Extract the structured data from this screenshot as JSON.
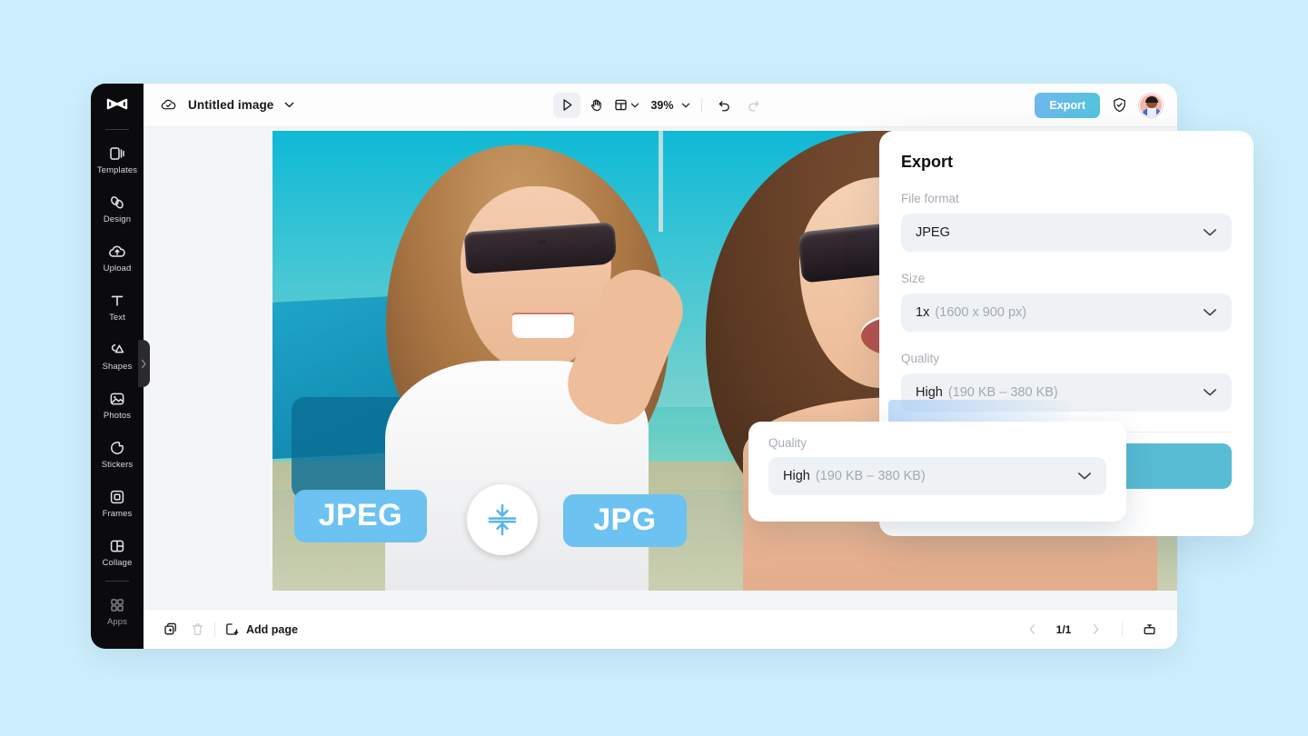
{
  "theme": {
    "page_bg": "#cdeefc",
    "rail_bg": "#0b0b0d",
    "canvas_bg": "#f4f5f7",
    "accent_blue": "#57bcd4",
    "badge_blue": "#6cc2f0",
    "export_gradient_from": "#6fb7ef",
    "export_gradient_to": "#54c3dd"
  },
  "sidebar": {
    "logo": "capcut-logo-icon",
    "items": [
      {
        "label": "Templates",
        "icon": "templates-icon"
      },
      {
        "label": "Design",
        "icon": "design-icon"
      },
      {
        "label": "Upload",
        "icon": "upload-cloud-icon"
      },
      {
        "label": "Text",
        "icon": "text-t-icon"
      },
      {
        "label": "Shapes",
        "icon": "shapes-icon"
      },
      {
        "label": "Photos",
        "icon": "photo-icon"
      },
      {
        "label": "Stickers",
        "icon": "sticker-icon"
      },
      {
        "label": "Frames",
        "icon": "frame-icon"
      },
      {
        "label": "Collage",
        "icon": "collage-icon"
      },
      {
        "label": "Apps",
        "icon": "apps-grid-icon"
      }
    ],
    "collapse_handle_icon": "chevron-right-icon"
  },
  "header": {
    "cloud_status_icon": "cloud-check-icon",
    "doc_title": "Untitled image",
    "doc_title_chevron_icon": "chevron-down-icon",
    "tools": [
      {
        "name": "select-tool",
        "icon": "cursor-arrow-icon",
        "active": true
      },
      {
        "name": "hand-tool",
        "icon": "hand-icon",
        "active": false
      },
      {
        "name": "layout-tool",
        "icon": "layout-panel-icon",
        "active": false
      }
    ],
    "layout_chevron_icon": "chevron-down-icon",
    "zoom_level": "39%",
    "zoom_chevron_icon": "chevron-down-icon",
    "undo_icon": "undo-arrow-icon",
    "redo_icon": "redo-arrow-icon",
    "export_label": "Export",
    "shield_icon": "shield-check-icon",
    "avatar": "user-avatar"
  },
  "canvas": {
    "badges": {
      "left_format": "JPEG",
      "right_format": "JPG",
      "compress_icon": "compress-vertical-icon"
    }
  },
  "bottombar": {
    "duplicate_icon": "duplicate-page-icon",
    "delete_icon": "trash-icon",
    "add_page_icon": "add-page-icon",
    "add_page_label": "Add page",
    "prev_page_icon": "chevron-left-icon",
    "page_indicator": "1/1",
    "next_page_icon": "chevron-right-icon",
    "present_icon": "present-icon"
  },
  "export_panel": {
    "title": "Export",
    "fields": [
      {
        "label": "File format",
        "value_main": "JPEG",
        "value_sub": "",
        "chevron_icon": "chevron-down-icon"
      },
      {
        "label": "Size",
        "value_main": "1x",
        "value_sub": "(1600 x 900 px)",
        "chevron_icon": "chevron-down-icon"
      },
      {
        "label": "Quality",
        "value_main": "High",
        "value_sub": "(190 KB – 380 KB)",
        "chevron_icon": "chevron-down-icon"
      }
    ],
    "cta_label": ""
  },
  "quality_popup": {
    "label": "Quality",
    "value_main": "High",
    "value_sub": "(190 KB – 380 KB)",
    "chevron_icon": "chevron-down-icon"
  }
}
